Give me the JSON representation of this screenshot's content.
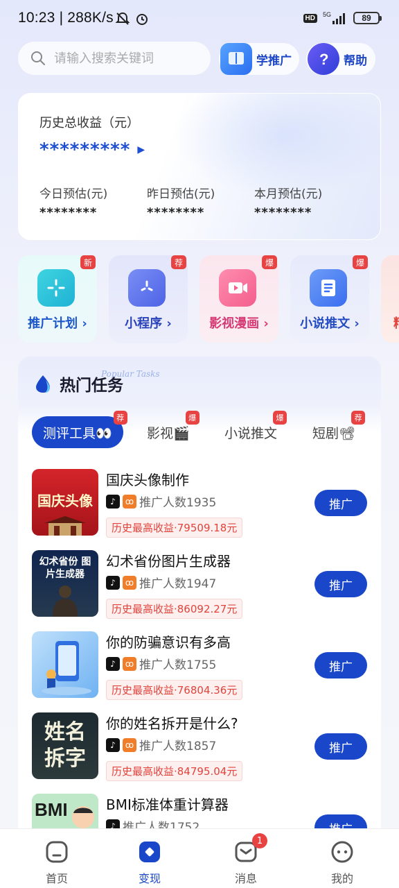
{
  "status_bar": {
    "time": "10:23 | 288K/s",
    "network": "5G",
    "hd": "HD",
    "battery": "89"
  },
  "search": {
    "placeholder": "请输入搜索关键词"
  },
  "header_buttons": {
    "learn": "学推广",
    "help": "帮助"
  },
  "earnings": {
    "title": "历史总收益（元）",
    "total": "*********",
    "today_label": "今日预估(元)",
    "today_value": "********",
    "yesterday_label": "昨日预估(元)",
    "yesterday_value": "********",
    "month_label": "本月预估(元)",
    "month_value": "********"
  },
  "categories": [
    {
      "label": "推广计划",
      "tag": "新",
      "icon": "sparkle-icon"
    },
    {
      "label": "小程序",
      "tag": "荐",
      "icon": "mini-program-icon"
    },
    {
      "label": "影视漫画",
      "tag": "爆",
      "icon": "video-camera-icon"
    },
    {
      "label": "小说推文",
      "tag": "爆",
      "icon": "document-icon"
    },
    {
      "label": "精",
      "tag": "",
      "icon": ""
    }
  ],
  "hot": {
    "title": "热门任务",
    "subtitle": "Popular Tasks",
    "tabs": [
      {
        "label": "测评工具👀",
        "tag": "荐"
      },
      {
        "label": "影视🎬",
        "tag": "爆"
      },
      {
        "label": "小说推文",
        "tag": "爆"
      },
      {
        "label": "短剧📽",
        "tag": "荐"
      }
    ],
    "items": [
      {
        "title": "国庆头像制作",
        "count": "推广人数1935",
        "earn": "历史最高收益·79509.18元",
        "button": "推广",
        "thumb_text": "国庆头像"
      },
      {
        "title": "幻术省份图片生成器",
        "count": "推广人数1947",
        "earn": "历史最高收益·86092.27元",
        "button": "推广",
        "thumb_text": "幻术省份 图片生成器"
      },
      {
        "title": "你的防骗意识有多高",
        "count": "推广人数1755",
        "earn": "历史最高收益·76804.36元",
        "button": "推广",
        "thumb_text": ""
      },
      {
        "title": "你的姓名拆开是什么?",
        "count": "推广人数1857",
        "earn": "历史最高收益·84795.04元",
        "button": "推广",
        "thumb_text": "姓名 拆字"
      },
      {
        "title": "BMI标准体重计算器",
        "count": "推广人数1752",
        "earn": "",
        "button": "推广",
        "thumb_text": "BMI"
      }
    ]
  },
  "nav": {
    "home": "首页",
    "cash": "变现",
    "messages": "消息",
    "messages_badge": "1",
    "mine": "我的"
  },
  "colors": {
    "primary": "#1a47c9",
    "tag_red": "#e74343",
    "earn_red": "#e0443c"
  }
}
